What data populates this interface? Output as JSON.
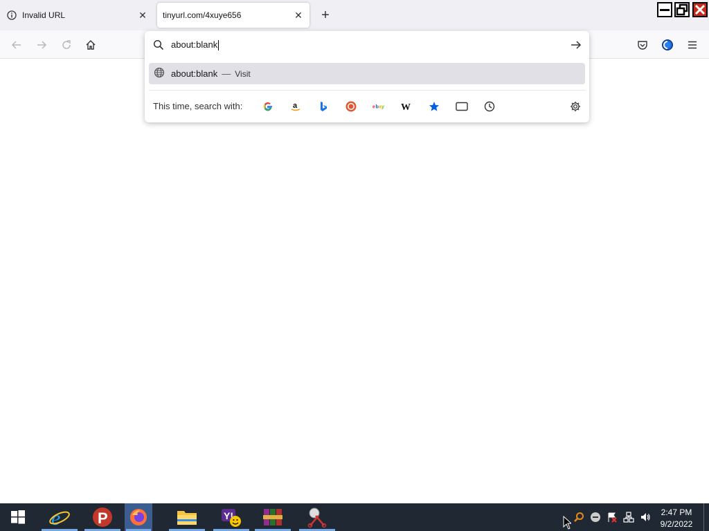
{
  "tabs": [
    {
      "title": "Invalid URL",
      "active": false
    },
    {
      "title": "tinyurl.com/4xuye656",
      "active": true
    }
  ],
  "urlbar": {
    "value": "about:blank"
  },
  "suggestion": {
    "text": "about:blank",
    "separator": "—",
    "action": "Visit"
  },
  "search_with": {
    "label": "This time, search with:",
    "engines": [
      "google",
      "amazon",
      "bing",
      "duckduckgo",
      "ebay",
      "wikipedia",
      "bookmarks",
      "tabs",
      "history"
    ]
  },
  "clock": {
    "time": "2:47 PM",
    "date": "9/2/2022"
  },
  "colors": {
    "accent": "#0061e0",
    "taskbar": "#202834",
    "highlight": "#e0e0e6"
  }
}
